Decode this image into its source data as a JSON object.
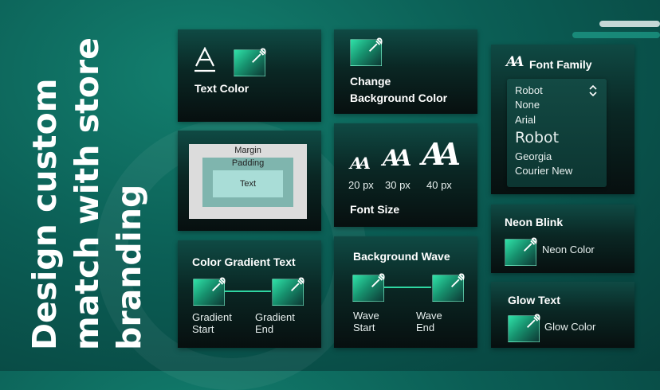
{
  "headline": {
    "lines": [
      "Design custom",
      "match with store",
      "branding"
    ]
  },
  "colors": {
    "accent": "#2fd6a2",
    "background": "#0b5e55",
    "card": "#0a2724"
  },
  "text_color": {
    "label": "Text Color",
    "icon": "text-color-icon",
    "picker_icon": "eyedropper-icon"
  },
  "background_color": {
    "label_line1": "Change",
    "label_line2": "Background Color",
    "picker_icon": "eyedropper-icon"
  },
  "font_family": {
    "title": "Font Family",
    "icon": "font-family-icon",
    "selected": "Robot",
    "options": [
      "None",
      "Arial",
      "Robot",
      "Georgia",
      "Courier New"
    ]
  },
  "box_model": {
    "margin": "Margin",
    "padding": "Padding",
    "content": "Text"
  },
  "font_size": {
    "title": "Font Size",
    "icon_glyph": "AA",
    "sizes": [
      {
        "label": "20 px"
      },
      {
        "label": "30 px"
      },
      {
        "label": "40 px"
      }
    ]
  },
  "neon_blink": {
    "title": "Neon Blink",
    "picker_label": "Neon Color"
  },
  "gradient_text": {
    "title": "Color Gradient Text",
    "start": [
      "Gradient",
      "Start"
    ],
    "end": [
      "Gradient",
      "End"
    ]
  },
  "background_wave": {
    "title": "Background Wave",
    "start": [
      "Wave",
      "Start"
    ],
    "end": [
      "Wave",
      "End"
    ]
  },
  "glow_text": {
    "title": "Glow Text",
    "picker_label": "Glow Color"
  }
}
